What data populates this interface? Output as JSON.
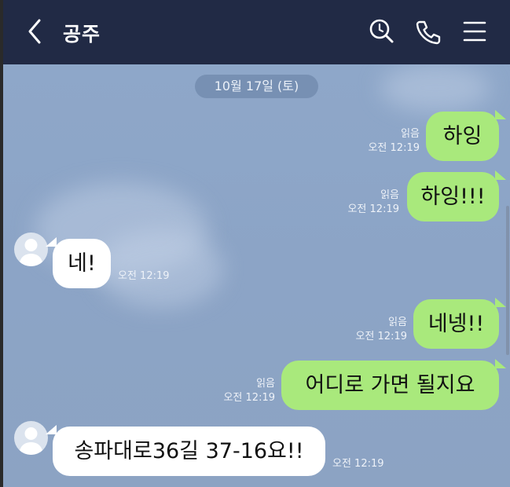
{
  "header": {
    "title": "공주",
    "back_icon": "chevron-left-icon",
    "search_icon": "search-icon",
    "call_icon": "phone-icon",
    "menu_icon": "hamburger-menu-icon",
    "bg_color": "#212a45"
  },
  "chat": {
    "date_divider": "10월 17일 (토)",
    "bg_color": "#8ea7c9",
    "messages": [
      {
        "side": "mine",
        "text": "하잉",
        "read": "읽음",
        "time": "오전 12:19"
      },
      {
        "side": "mine",
        "text": "하잉!!!",
        "read": "읽음",
        "time": "오전 12:19"
      },
      {
        "side": "theirs",
        "text": "네!",
        "time": "오전 12:19"
      },
      {
        "side": "mine",
        "text": "네넹!!",
        "read": "읽음",
        "time": "오전 12:19"
      },
      {
        "side": "mine",
        "text": "어디로 가면 될지요",
        "read": "읽음",
        "time": "오전 12:19"
      },
      {
        "side": "theirs",
        "text": "송파대로36길 37-16요!!",
        "time": "오전 12:19"
      }
    ]
  },
  "colors": {
    "my_bubble": "#a9e97c",
    "their_bubble": "#ffffff"
  }
}
